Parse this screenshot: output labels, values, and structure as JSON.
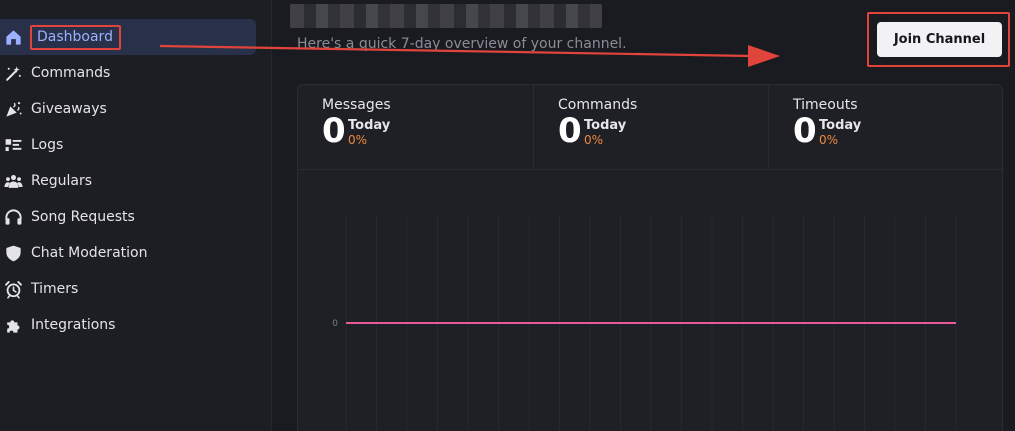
{
  "sidebar": {
    "items": [
      {
        "label": "Dashboard",
        "icon": "home-icon",
        "active": true
      },
      {
        "label": "Commands",
        "icon": "magic-wand-icon"
      },
      {
        "label": "Giveaways",
        "icon": "party-popper-icon"
      },
      {
        "label": "Logs",
        "icon": "list-icon"
      },
      {
        "label": "Regulars",
        "icon": "users-icon"
      },
      {
        "label": "Song Requests",
        "icon": "headphones-icon"
      },
      {
        "label": "Chat Moderation",
        "icon": "shield-icon"
      },
      {
        "label": "Timers",
        "icon": "alarm-clock-icon"
      },
      {
        "label": "Integrations",
        "icon": "puzzle-icon"
      }
    ]
  },
  "header": {
    "subtitle": "Here's a quick 7-day overview of your channel.",
    "join_button": "Join Channel"
  },
  "stats": [
    {
      "label": "Messages",
      "value": "0",
      "period": "Today",
      "change": "0%"
    },
    {
      "label": "Commands",
      "value": "0",
      "period": "Today",
      "change": "0%"
    },
    {
      "label": "Timeouts",
      "value": "0",
      "period": "Today",
      "change": "0%"
    }
  ],
  "colors": {
    "accent": "#9bb0ff",
    "line": "#e8599a",
    "highlight": "#e0443a",
    "change": "#f0883e"
  },
  "chart_data": {
    "type": "line",
    "y_tick_labels": [
      "0"
    ],
    "series": [
      {
        "values": [
          0,
          0,
          0,
          0,
          0,
          0,
          0
        ]
      }
    ],
    "grid": true
  }
}
